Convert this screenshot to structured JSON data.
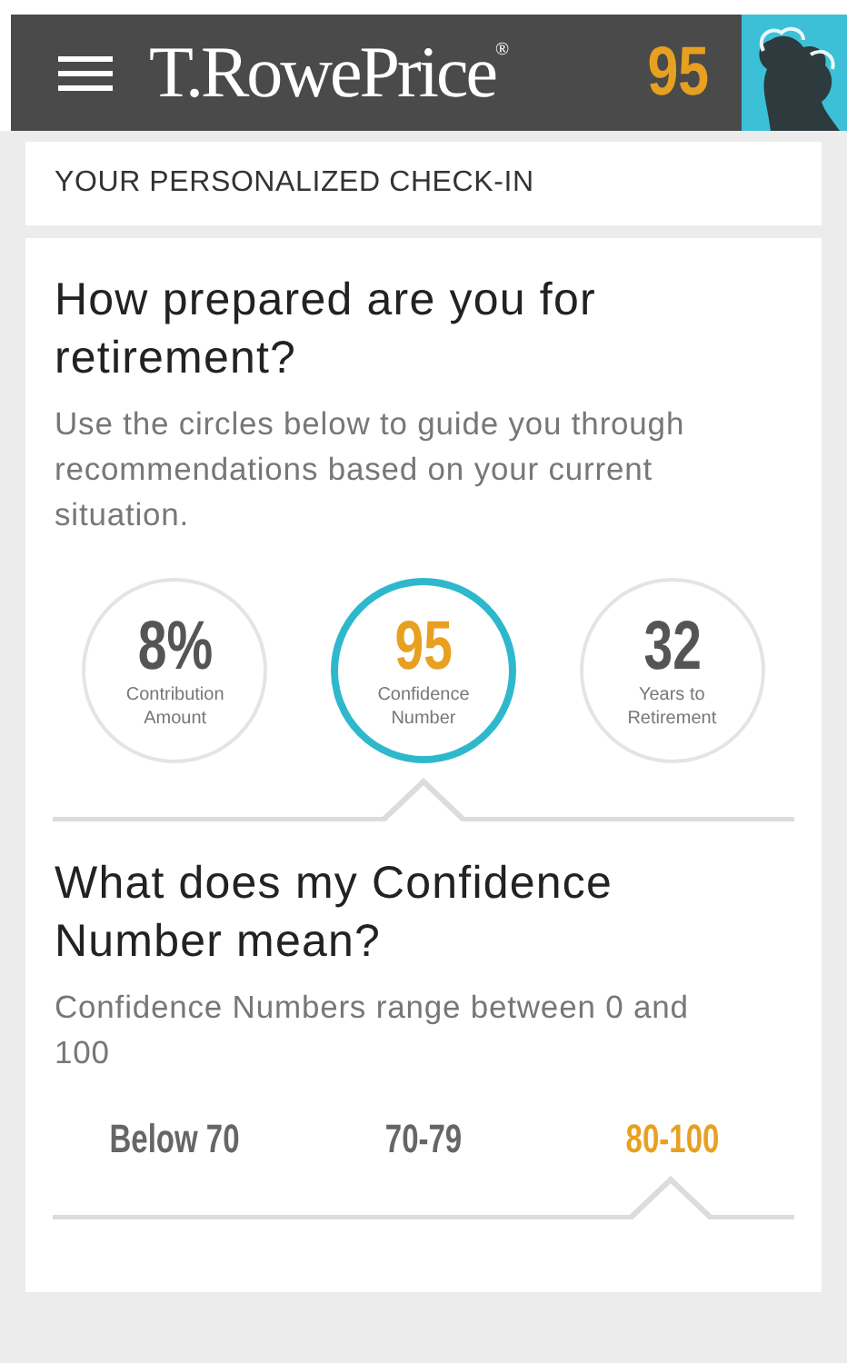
{
  "header": {
    "logo": "T.RowePrice",
    "logo_mark": "®",
    "score": "95"
  },
  "check_in": {
    "title": "YOUR PERSONALIZED CHECK-IN"
  },
  "retirement": {
    "heading": "How prepared are you for retirement?",
    "description": "Use the circles below to guide you through recommendations based on your current situation.",
    "circles": [
      {
        "value": "8%",
        "label": "Contribution Amount",
        "selected": false
      },
      {
        "value": "95",
        "label": "Confidence Number",
        "selected": true
      },
      {
        "value": "32",
        "label": "Years to Retirement",
        "selected": false
      }
    ]
  },
  "meaning": {
    "heading": "What does my Confidence Number mean?",
    "description": "Confidence Numbers range between 0 and 100",
    "ranges": [
      {
        "label": "Below 70",
        "selected": false
      },
      {
        "label": "70-79",
        "selected": false
      },
      {
        "label": "80-100",
        "selected": true
      }
    ]
  }
}
